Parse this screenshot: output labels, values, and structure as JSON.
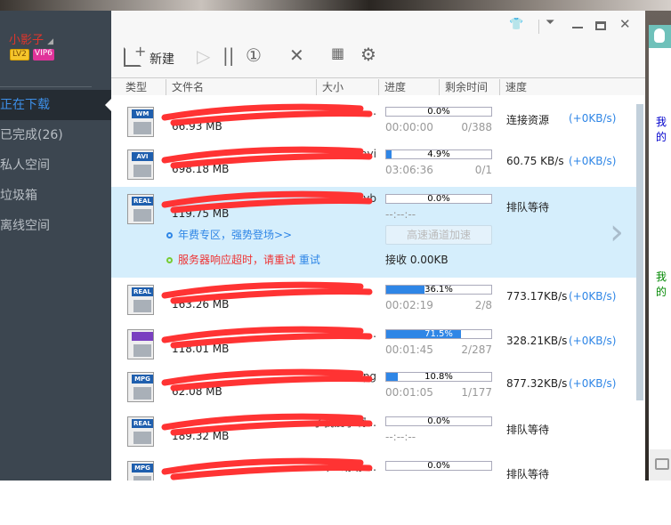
{
  "user": {
    "name": "小影子",
    "level": "LV2",
    "vip": "VIP6"
  },
  "sidebar": {
    "items": [
      {
        "label": "正在下载"
      },
      {
        "label": "已完成(26)"
      },
      {
        "label": "私人空间"
      },
      {
        "label": "垃圾箱"
      },
      {
        "label": "离线空间"
      }
    ]
  },
  "toolbar": {
    "new_label": "新建"
  },
  "columns": {
    "type": "类型",
    "name": "文件名",
    "size": "大小",
    "progress": "进度",
    "remaining": "剩余时间",
    "speed": "速度"
  },
  "rows": [
    {
      "type": "WM",
      "name": "...",
      "size": "66.93 MB",
      "progress": "0.0%",
      "pct": 0,
      "time": "00:00:00",
      "count": "0/388",
      "status": "连接资源",
      "plus": "(+0KB/s)"
    },
    {
      "type": "AVI",
      "name": ".avi",
      "size": "698.18 MB",
      "progress": "4.9%",
      "pct": 4.9,
      "time": "03:06:36",
      "count": "0/1",
      "status": "60.75  KB/s",
      "plus": "(+0KB/s)"
    },
    {
      "type": "REAL",
      "name": ".rmvb",
      "size": "119.75 MB",
      "progress": "0.0%",
      "pct": 0,
      "time": "--:--:--",
      "count": "",
      "status": "排队等待",
      "plus": "",
      "promo": "年费专区，强势登场>>",
      "accel": "高速通道加速",
      "error": "服务器响应超时，请重试",
      "retry": "重试",
      "recv": "接收 0.00KB"
    },
    {
      "type": "REAL",
      "name": "",
      "size": "163.26 MB",
      "progress": "36.1%",
      "pct": 36.1,
      "time": "00:02:19",
      "count": "2/8",
      "status": "773.17KB/s",
      "plus": "(+0KB/s)"
    },
    {
      "type": "",
      "name": "...",
      "size": "118.01 MB",
      "progress": "71.5%",
      "pct": 71.5,
      "time": "00:01:45",
      "count": "2/287",
      "status": "328.21KB/s",
      "plus": "(+0KB/s)"
    },
    {
      "type": "MPG",
      "name": ".mpg",
      "size": "62.08 MB",
      "progress": "10.8%",
      "pct": 10.8,
      "time": "00:01:05",
      "count": "1/177",
      "status": "877.32KB/s",
      "plus": "(+0KB/s)"
    },
    {
      "type": "REAL",
      "name": "了我爱了啊...",
      "size": "189.32 MB",
      "progress": "0.0%",
      "pct": 0,
      "time": "--:--:--",
      "count": "",
      "status": "排队等待",
      "plus": ""
    },
    {
      "type": "MPG",
      "name": "）-幼幼-...",
      "size": "",
      "progress": "0.0%",
      "pct": 0,
      "time": "",
      "count": "",
      "status": "排队等待",
      "plus": ""
    }
  ],
  "qq": {
    "text1": "我的",
    "text2": "我的"
  }
}
